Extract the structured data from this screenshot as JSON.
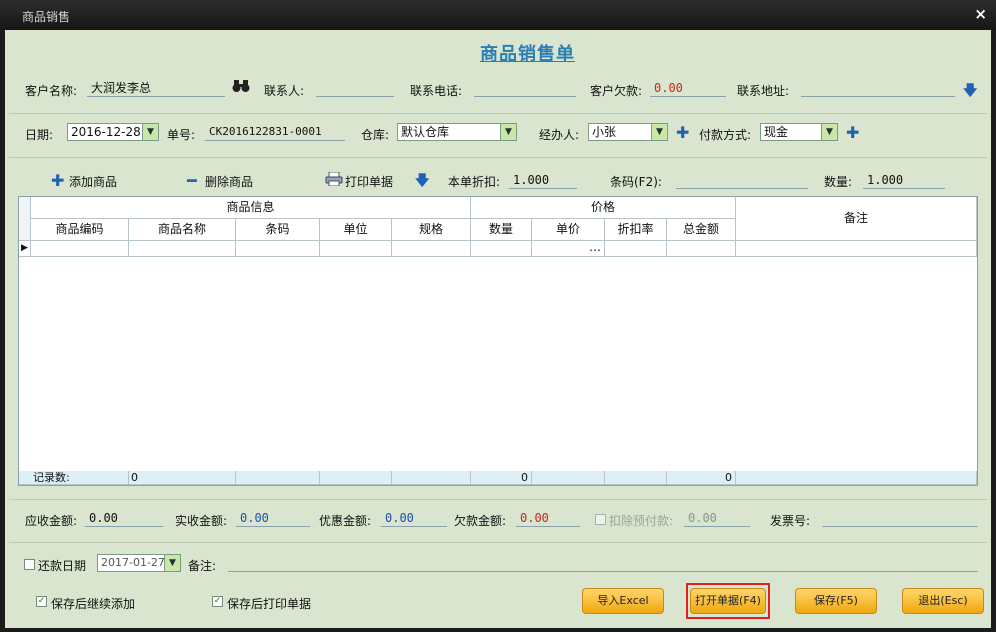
{
  "window": {
    "title": "商品销售",
    "close": "×"
  },
  "form_title": "商品销售单",
  "row1": {
    "customer_label": "客户名称:",
    "customer_value": "大润发李总",
    "contact_label": "联系人:",
    "contact_value": "",
    "phone_label": "联系电话:",
    "phone_value": "",
    "debt_label": "客户欠款:",
    "debt_value": "0.00",
    "address_label": "联系地址:",
    "address_value": ""
  },
  "row2": {
    "date_label": "日期:",
    "date_value": "2016-12-28",
    "order_label": "单号:",
    "order_value": "CK2016122831-0001",
    "warehouse_label": "仓库:",
    "warehouse_value": "默认仓库",
    "handler_label": "经办人:",
    "handler_value": "小张",
    "payment_label": "付款方式:",
    "payment_value": "现金"
  },
  "toolbar": {
    "add_label": "添加商品",
    "delete_label": "删除商品",
    "print_label": "打印单据",
    "discount_label": "本单折扣:",
    "discount_value": "1.000",
    "barcode_label": "条码(F2):",
    "barcode_value": "",
    "qty_label": "数量:",
    "qty_value": "1.000"
  },
  "grid": {
    "group_product": "商品信息",
    "group_price": "价格",
    "remark": "备注",
    "columns": [
      "商品编码",
      "商品名称",
      "条码",
      "单位",
      "规格",
      "数量",
      "单价",
      "折扣率",
      "总金额"
    ],
    "row_indicator": "▶",
    "ellipsis": "…",
    "footer_label": "记录数:",
    "footer_count": "0",
    "footer_qty": "0",
    "footer_total": "0"
  },
  "totals": {
    "receivable_label": "应收金额:",
    "receivable_value": "0.00",
    "received_label": "实收金额:",
    "received_value": "0.00",
    "discount_amount_label": "优惠金额:",
    "discount_amount_value": "0.00",
    "arrears_label": "欠款金额:",
    "arrears_value": "0.00",
    "deduct_prepaid_label": "扣除预付款:",
    "deduct_prepaid_value": "0.00",
    "invoice_label": "发票号:",
    "invoice_value": ""
  },
  "repay": {
    "repay_date_label": "还款日期",
    "repay_date_value": "2017-01-27",
    "remark_label": "备注:",
    "remark_value": ""
  },
  "options": {
    "continue_add_label": "保存后继续添加",
    "print_after_save_label": "保存后打印单据"
  },
  "buttons": {
    "import_excel": "导入Excel",
    "open_doc": "打开单据(F4)",
    "save": "保存(F5)",
    "exit": "退出(Esc)"
  },
  "colors": {
    "form_bg": "#d9e5ce",
    "title_blue": "#2a7fb3",
    "red_value": "#d42020",
    "blue_value": "#1f4fb4",
    "highlight": "#e02020"
  }
}
